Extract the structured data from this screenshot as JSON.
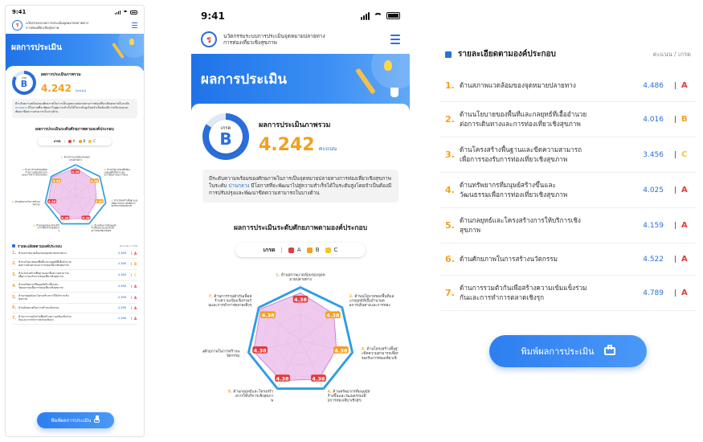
{
  "status": {
    "time": "9:41"
  },
  "app": {
    "name_line1": "นวัตกรรมระบบการประเมินจุดหมายปลายทาง",
    "name_line2": "การท่องเที่ยวเชิงสุขภาพ",
    "logo_glyph": "ร"
  },
  "banner": {
    "title": "ผลการประเมิน"
  },
  "overall": {
    "grade_caption": "เกรด",
    "grade": "B",
    "title": "ผลการประเมินภาพรวม",
    "score": "4.242",
    "unit": "คะแนน",
    "gauge_fraction": 0.84
  },
  "description": {
    "part1": "มีระดับความพร้อมของศักยภาพในการเป็นจุดหมายปลายทางการท่องเที่ยวเชิงสุขภาพในระดับ ",
    "highlight": "ปานกลาง",
    "part2": " มีโอกาสที่จะพัฒนาไปสู่ความสำเร็จได้ในระดับสูงโดยจำเป็นต้องมีการปรับปรุงและพัฒนาขีดความสามารถในบางด้าน"
  },
  "component_section": {
    "title": "ผลการประเมินระดับศักยภาพตามองค์ประกอบ"
  },
  "legend": {
    "label": "เกรด",
    "items": [
      {
        "letter": "A",
        "color": "#e23b3b"
      },
      {
        "letter": "B",
        "color": "#f3a020"
      },
      {
        "letter": "C",
        "color": "#f4c430"
      }
    ]
  },
  "radar": {
    "badge_value": "4.38",
    "labels": [
      {
        "num": "1.",
        "text": "ด้านสภาพแวดล้อมของจุดหมายปลายทาง"
      },
      {
        "num": "2.",
        "text": "ด้านนโยบายของพื้นที่และกลยุทธ์ที่เอื้ออำนวยต่อการเดินทางและการท่องเที่ยวเชิงสุขภาพ"
      },
      {
        "num": "3.",
        "text": "ด้านโครงสร้างพื้นฐานและขีดความสามารถเพื่อการรองรับการท่องเที่ยวเชิงสุขภาพ"
      },
      {
        "num": "4.",
        "text": "ด้านทรัพยากรที่มนุษย์สร้างขึ้นและวัฒนธรรมเพื่อการท่องเที่ยวเชิงสุขภาพ"
      },
      {
        "num": "5.",
        "text": "ด้านกลยุทธ์และโครงสร้างการให้บริการเชิงสุขภาพ"
      },
      {
        "num": "6.",
        "text": "ด้านศักยภาพในการสร้างนวัตกรรม"
      },
      {
        "num": "7.",
        "text": "ด้านการรวมตัวกันเพื่อสร้างความเข้มแข็งร่วมกันและการทำการตลาดเชิงรุก"
      }
    ],
    "values": [
      4.486,
      4.016,
      3.456,
      4.025,
      4.159,
      4.522,
      4.789
    ],
    "max": 5,
    "fill_color": "#e9b7e8",
    "stroke_color": "#c77fcc",
    "frame_color": "#2f9de0"
  },
  "detail": {
    "title": "รายละเอียดตามองค์ประกอบ",
    "unit": "คะแนน / เกรด",
    "rows": [
      {
        "num": "1.",
        "label": "ด้านสภาพแวดล้อมของจุดหมายปลายทาง",
        "label2": "",
        "score": "4.486",
        "grade": "A"
      },
      {
        "num": "2.",
        "label": "ด้านนโยบายของพื้นที่และกลยุทธ์ที่เอื้ออำนวย",
        "label2": "ต่อการเดินทางและการท่องเที่ยวเชิงสุขภาพ",
        "score": "4.016",
        "grade": "B"
      },
      {
        "num": "3.",
        "label": "ด้านโครงสร้างพื้นฐานและขีดความสามารถ",
        "label2": "เพื่อการรองรับการท่องเที่ยวเชิงสุขภาพ",
        "score": "3.456",
        "grade": "C"
      },
      {
        "num": "4.",
        "label": "ด้านทรัพยากรที่มนุษย์สร้างขึ้นและ",
        "label2": "วัฒนธรรมเพื่อการท่องเที่ยวเชิงสุขภาพ",
        "score": "4.025",
        "grade": "A"
      },
      {
        "num": "5.",
        "label": "ด้านกลยุทธ์และโครงสร้างการให้บริการเชิง",
        "label2": "สุขภาพ",
        "score": "4.159",
        "grade": "A"
      },
      {
        "num": "6.",
        "label": "ด้านศักยภาพในการสร้างนวัตกรรม",
        "label2": "",
        "score": "4.522",
        "grade": "A"
      },
      {
        "num": "7.",
        "label": "ด้านการรวมตัวกันเพื่อสร้างความเข้มแข็งร่วม",
        "label2": "กันและการทำการตลาดเชิงรุก",
        "score": "4.789",
        "grade": "A"
      }
    ],
    "separator": "|"
  },
  "small_detail_scores": [
    "4.386",
    "4.386",
    "4.386",
    "4.386",
    "4.386",
    "4.386",
    "4.386"
  ],
  "print_button": {
    "label": "พิมพ์ผลการประเมิน"
  }
}
